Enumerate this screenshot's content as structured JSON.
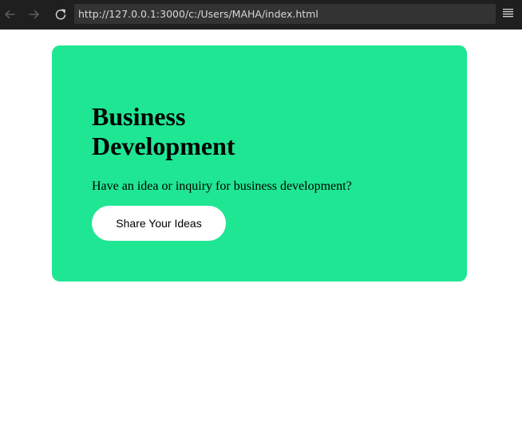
{
  "browser": {
    "url": "http://127.0.0.1:3000/c:/Users/MAHA/index.html",
    "icons": {
      "back": "arrow-left-icon",
      "forward": "arrow-right-icon",
      "reload": "reload-icon",
      "menu": "hamburger-menu-icon"
    }
  },
  "card": {
    "title": "Business Development",
    "subtitle": "Have an idea or inquiry for business development?",
    "button_label": "Share Your Ideas"
  },
  "colors": {
    "toolbar_bg": "#1f1f1f",
    "address_bg": "#333333",
    "card_bg": "#1fe693",
    "button_bg": "#ffffff"
  }
}
